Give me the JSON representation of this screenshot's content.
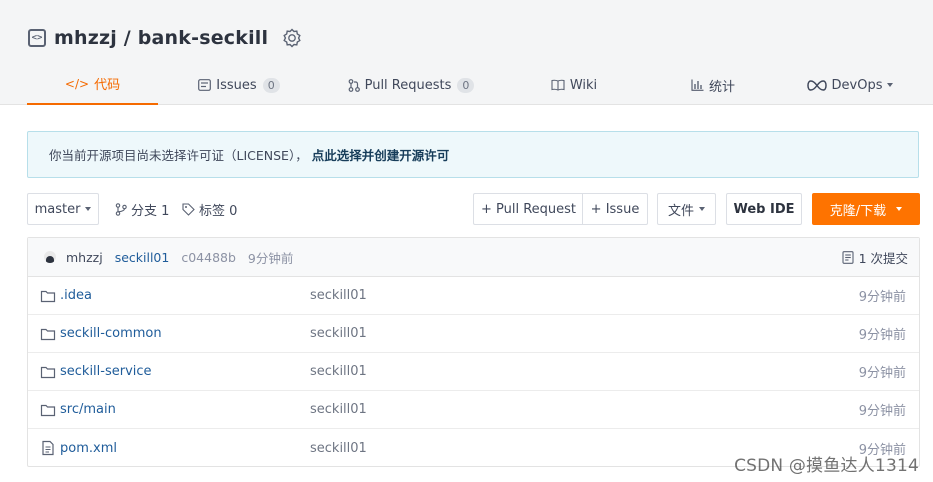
{
  "repo": {
    "title": "mhzzj / bank-seckill",
    "code_icon_glyph": "<>"
  },
  "tabs": [
    {
      "label": "代码",
      "icon": "code-icon",
      "glyph": "</>",
      "active": true
    },
    {
      "label": "Issues",
      "icon": "issue-icon",
      "count": "0"
    },
    {
      "label": "Pull Requests",
      "icon": "pull-request-icon",
      "count": "0"
    },
    {
      "label": "Wiki",
      "icon": "book-icon"
    },
    {
      "label": "统计",
      "icon": "chart-icon"
    },
    {
      "label": "DevOps",
      "icon": "infinity-icon"
    }
  ],
  "notice": {
    "text": "你当前开源项目尚未选择许可证（LICENSE），",
    "link": "点此选择并创建开源许可"
  },
  "toolbar": {
    "branch": "master",
    "branches": "分支 1",
    "tags": "标签 0",
    "pull_request": "+ Pull Request",
    "issue": "+ Issue",
    "file": "文件",
    "webide": "Web IDE",
    "clone": "克隆/下载"
  },
  "commit": {
    "author": "mhzzj",
    "message": "seckill01",
    "hash": "c04488b",
    "time": "9分钟前",
    "count": "1 次提交"
  },
  "files": [
    {
      "name": ".idea",
      "type": "folder",
      "message": "seckill01",
      "time": "9分钟前"
    },
    {
      "name": "seckill-common",
      "type": "folder",
      "message": "seckill01",
      "time": "9分钟前"
    },
    {
      "name": "seckill-service",
      "type": "folder",
      "message": "seckill01",
      "time": "9分钟前"
    },
    {
      "name": "src/main",
      "type": "folder",
      "message": "seckill01",
      "time": "9分钟前"
    },
    {
      "name": "pom.xml",
      "type": "file",
      "message": "seckill01",
      "time": "9分钟前"
    }
  ],
  "watermark": "CSDN @摸鱼达人1314",
  "colors": {
    "accent": "#f56a00",
    "clone_button": "#fe7300",
    "link": "#1f5c9a",
    "notice_bg": "#eef8fb"
  }
}
